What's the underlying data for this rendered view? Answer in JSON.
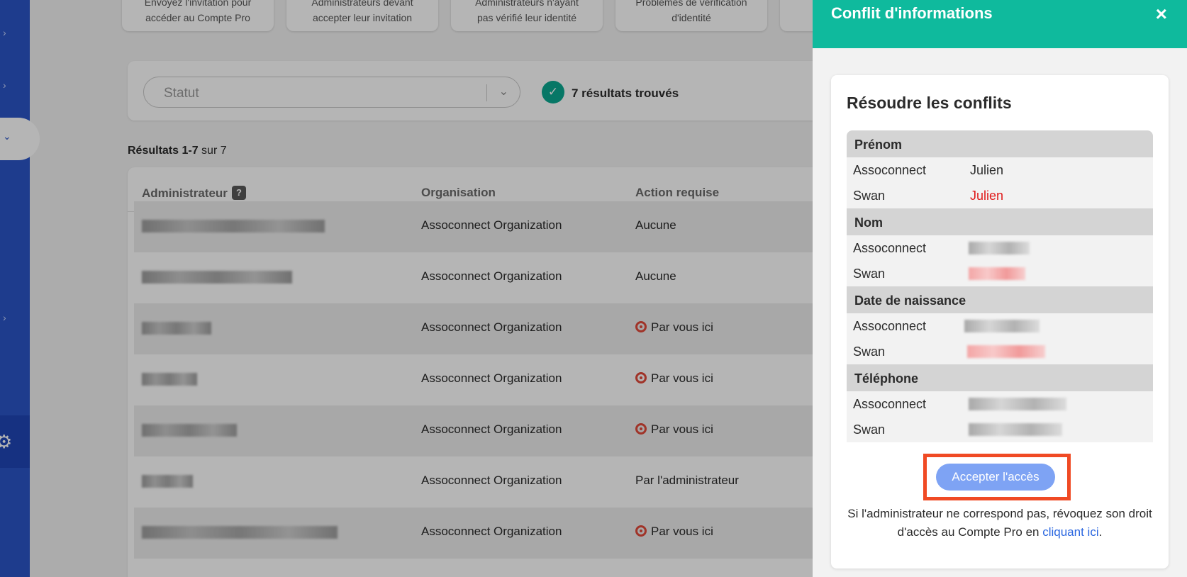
{
  "top_cards": [
    {
      "line1": "Envoyez l'invitation pour",
      "line2": "accéder au Compte Pro"
    },
    {
      "line1": "Administrateurs devant",
      "line2": "accepter leur invitation"
    },
    {
      "line1": "Administrateurs n'ayant",
      "line2": "pas vérifié leur identité"
    },
    {
      "line1": "Problèmes de vérification",
      "line2": "d'identité"
    }
  ],
  "filter": {
    "status_placeholder": "Statut",
    "results_found": "7 résultats trouvés"
  },
  "results": {
    "range": "Résultats 1-7",
    "total": "sur 7"
  },
  "table": {
    "headers": {
      "admin": "Administrateur",
      "help": "?",
      "organization": "Organisation",
      "action": "Action requise"
    },
    "rows": [
      {
        "organization": "Assoconnect Organization",
        "action": "Aucune",
        "action_icon": ""
      },
      {
        "organization": "Assoconnect Organization",
        "action": "Aucune",
        "action_icon": ""
      },
      {
        "organization": "Assoconnect Organization",
        "action": "Par vous ici",
        "action_icon": "target-icon"
      },
      {
        "organization": "Assoconnect Organization",
        "action": "Par vous ici",
        "action_icon": "target-icon"
      },
      {
        "organization": "Assoconnect Organization",
        "action": "Par vous ici",
        "action_icon": "target-icon"
      },
      {
        "organization": "Assoconnect Organization",
        "action": "Par l'administrateur",
        "action_icon": ""
      },
      {
        "organization": "Assoconnect Organization",
        "action": "Par vous ici",
        "action_icon": "target-icon"
      }
    ]
  },
  "panel": {
    "title": "Conflit d'informations",
    "close_icon": "×",
    "card_title": "Résoudre les conflits",
    "sections": [
      {
        "label": "Prénom",
        "rows": [
          {
            "source": "Assoconnect",
            "value": "Julien",
            "masked": false,
            "conflict": false
          },
          {
            "source": "Swan",
            "value": "Julien",
            "masked": false,
            "conflict": true
          }
        ]
      },
      {
        "label": "Nom",
        "rows": [
          {
            "source": "Assoconnect",
            "masked": true,
            "conflict": false
          },
          {
            "source": "Swan",
            "masked": true,
            "conflict": true
          }
        ]
      },
      {
        "label": "Date de naissance",
        "rows": [
          {
            "source": "Assoconnect",
            "masked": true,
            "conflict": false
          },
          {
            "source": "Swan",
            "masked": true,
            "conflict": true
          }
        ]
      },
      {
        "label": "Téléphone",
        "rows": [
          {
            "source": "Assoconnect",
            "masked": true,
            "conflict": false
          },
          {
            "source": "Swan",
            "masked": true,
            "conflict": false
          }
        ]
      }
    ],
    "accept_label": "Accepter l'accès",
    "revoke_text": "Si l'administrateur ne correspond pas, révoquez son droit d'accès au Compte Pro en",
    "revoke_link": "cliquant ici",
    "revoke_end": "."
  },
  "colors": {
    "accent": "#0fba9d",
    "rail": "#2b55c7",
    "accept": "#7ea3f4",
    "highlight": "#f04a24",
    "conflict": "#e01919"
  }
}
